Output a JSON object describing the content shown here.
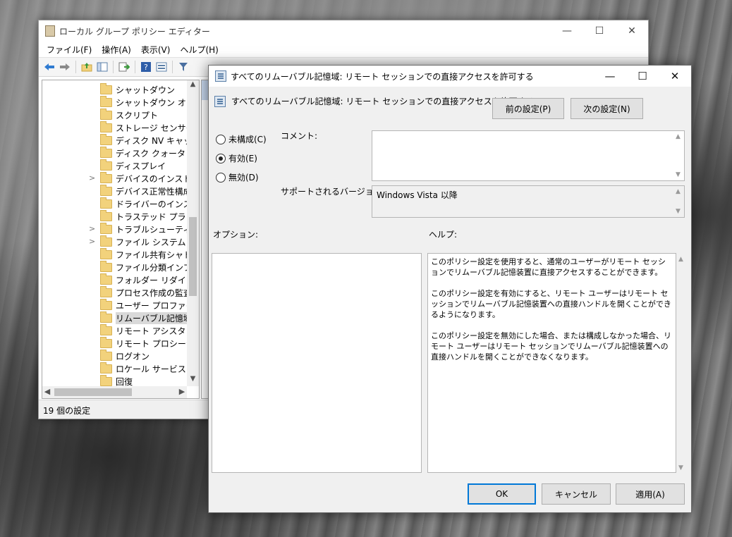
{
  "main_window": {
    "title": "ローカル グループ ポリシー エディター",
    "controls": {
      "minimize": "—",
      "maximize": "☐",
      "close": "✕"
    },
    "menu": [
      "ファイル(F)",
      "操作(A)",
      "表示(V)",
      "ヘルプ(H)"
    ],
    "toolbar_icons": [
      "back-icon",
      "forward-icon",
      "up-folder-icon",
      "show-hide-tree-icon",
      "export-list-icon",
      "help-icon",
      "properties-icon",
      "filter-icon"
    ],
    "tree_items": [
      {
        "label": "シャットダウン",
        "expandable": false
      },
      {
        "label": "シャットダウン オプショ",
        "expandable": false
      },
      {
        "label": "スクリプト",
        "expandable": false
      },
      {
        "label": "ストレージ センサー",
        "expandable": false
      },
      {
        "label": "ディスク NV キャッシュ",
        "expandable": false
      },
      {
        "label": "ディスク クォータ",
        "expandable": false
      },
      {
        "label": "ディスプレイ",
        "expandable": false
      },
      {
        "label": "デバイスのインストール",
        "expandable": true
      },
      {
        "label": "デバイス正常性構成証",
        "expandable": false
      },
      {
        "label": "ドライバーのインストール",
        "expandable": false
      },
      {
        "label": "トラステッド プラットフォ",
        "expandable": false
      },
      {
        "label": "トラブルシューティングと",
        "expandable": true
      },
      {
        "label": "ファイル システム",
        "expandable": true
      },
      {
        "label": "ファイル共有シャドウ コ",
        "expandable": false
      },
      {
        "label": "ファイル分類インフラス",
        "expandable": false
      },
      {
        "label": "フォルダー リダイレクト",
        "expandable": false
      },
      {
        "label": "プロセス作成の監査",
        "expandable": false
      },
      {
        "label": "ユーザー プロファイル",
        "expandable": false
      },
      {
        "label": "リムーバブル記憶域へ",
        "expandable": false,
        "selected": true
      },
      {
        "label": "リモート アシスタンス",
        "expandable": false
      },
      {
        "label": "リモート プロシージャ コ",
        "expandable": false
      },
      {
        "label": "ログオン",
        "expandable": false
      },
      {
        "label": "ロケール サービス",
        "expandable": false
      },
      {
        "label": "回復",
        "expandable": false
      }
    ],
    "status": "19 個の設定"
  },
  "dialog": {
    "title": "すべてのリムーバブル記憶域: リモート セッションでの直接アクセスを許可する",
    "setting_name": "すべてのリムーバブル記憶域: リモート セッションでの直接アクセスを許可する",
    "prev_button": "前の設定(P)",
    "next_button": "次の設定(N)",
    "radios": [
      {
        "label": "未構成(C)",
        "checked": false
      },
      {
        "label": "有効(E)",
        "checked": true
      },
      {
        "label": "無効(D)",
        "checked": false
      }
    ],
    "comment_label": "コメント:",
    "comment_value": "",
    "supported_label": "サポートされるバージョン:",
    "supported_value": "Windows Vista 以降",
    "options_label": "オプション:",
    "help_label": "ヘルプ:",
    "help_paragraphs": [
      "このポリシー設定を使用すると、通常のユーザーがリモート セッションでリムーバブル記憶装置に直接アクセスすることができます。",
      "このポリシー設定を有効にすると、リモート ユーザーはリモート セッションでリムーバブル記憶装置への直接ハンドルを開くことができるようになります。",
      "このポリシー設定を無効にした場合、または構成しなかった場合、リモート ユーザーはリモート セッションでリムーバブル記憶装置への直接ハンドルを開くことができなくなります。"
    ],
    "ok_button": "OK",
    "cancel_button": "キャンセル",
    "apply_button": "適用(A)"
  }
}
